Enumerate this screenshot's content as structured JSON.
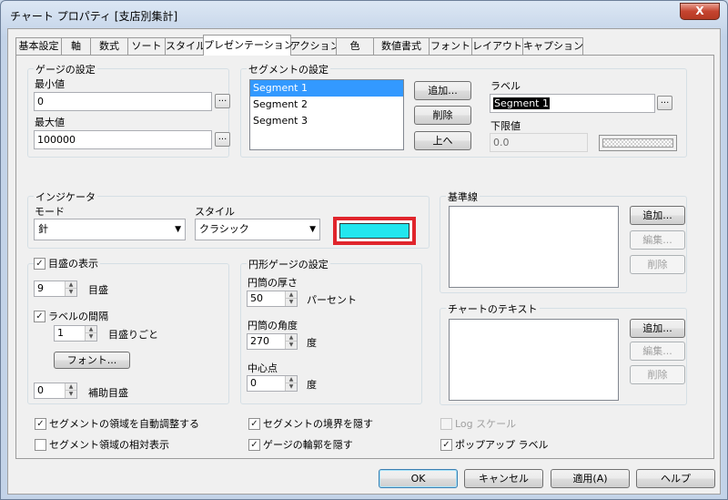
{
  "window": {
    "title": "チャート プロパティ [支店別集計]",
    "close_label": "X"
  },
  "tabs": [
    {
      "label": "基本設定"
    },
    {
      "label": "軸"
    },
    {
      "label": "数式"
    },
    {
      "label": "ソート"
    },
    {
      "label": "スタイル"
    },
    {
      "label": "プレゼンテーション"
    },
    {
      "label": "アクション"
    },
    {
      "label": "色"
    },
    {
      "label": "数値書式"
    },
    {
      "label": "フォント"
    },
    {
      "label": "レイアウト"
    },
    {
      "label": "キャプション"
    }
  ],
  "gauge_settings": {
    "title": "ゲージの設定",
    "min_label": "最小値",
    "min_value": "0",
    "max_label": "最大値",
    "max_value": "100000",
    "ellipsis": "..."
  },
  "segment_settings": {
    "title": "セグメントの設定",
    "segments": [
      "Segment 1",
      "Segment 2",
      "Segment 3"
    ],
    "add_button": "追加...",
    "delete_button": "削除",
    "up_button": "上へ",
    "label_label": "ラベル",
    "label_value": "Segment 1",
    "lower_label": "下限値",
    "lower_value": "0.0",
    "ellipsis": "..."
  },
  "indicator": {
    "title": "インジケータ",
    "mode_label": "モード",
    "mode_value": "針",
    "style_label": "スタイル",
    "style_value": "クラシック",
    "color": "#22e6ee"
  },
  "reference_lines": {
    "title": "基準線",
    "add_button": "追加...",
    "edit_button": "編集...",
    "delete_button": "削除"
  },
  "scale": {
    "show_scale_label": "目盛の表示",
    "show_scale_checked": true,
    "scale_count": "9",
    "scale_unit": "目盛",
    "label_interval_label": "ラベルの間隔",
    "label_interval_checked": true,
    "label_interval_value": "1",
    "label_interval_unit": "目盛りごと",
    "font_button": "フォント...",
    "minor_value": "0",
    "minor_label": "補助目盛"
  },
  "circular_gauge": {
    "title": "円形ゲージの設定",
    "thickness_label": "円筒の厚さ",
    "thickness_value": "50",
    "thickness_unit": "パーセント",
    "angle_label": "円筒の角度",
    "angle_value": "270",
    "angle_unit": "度",
    "center_label": "中心点",
    "center_value": "0",
    "center_unit": "度"
  },
  "chart_text": {
    "title": "チャートのテキスト",
    "add_button": "追加...",
    "edit_button": "編集...",
    "delete_button": "削除"
  },
  "options": {
    "auto_adjust": {
      "label": "セグメントの領域を自動調整する",
      "checked": true
    },
    "relative_display": {
      "label": "セグメント領域の相対表示",
      "checked": false
    },
    "hide_segment_border": {
      "label": "セグメントの境界を隠す",
      "checked": true
    },
    "hide_gauge_outline": {
      "label": "ゲージの輪郭を隠す",
      "checked": true
    },
    "log_scale": {
      "label": "Log スケール",
      "checked": false
    },
    "popup_label": {
      "label": "ポップアップ ラベル",
      "checked": true
    }
  },
  "footer": {
    "ok": "OK",
    "cancel": "キャンセル",
    "apply": "適用(A)",
    "help": "ヘルプ"
  },
  "check_glyph": "✓"
}
